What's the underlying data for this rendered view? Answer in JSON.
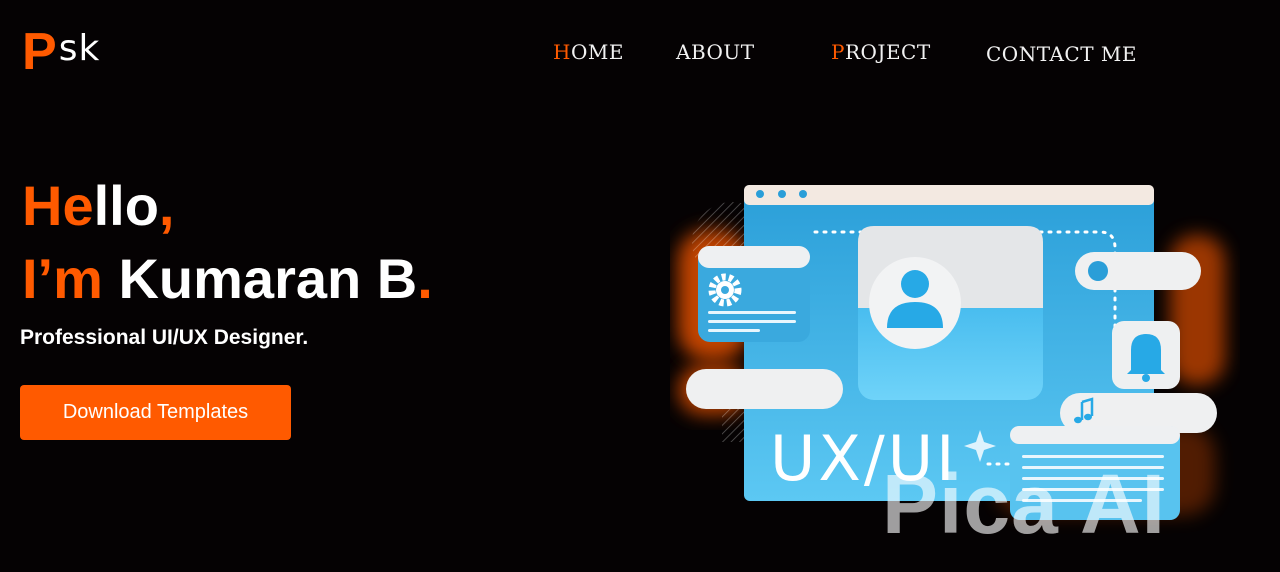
{
  "logo": {
    "initial": "P",
    "rest": "sk"
  },
  "nav": [
    {
      "first": "H",
      "rest": "OME"
    },
    {
      "first": "",
      "rest": "ABOUT"
    },
    {
      "first": "P",
      "rest": "ROJECT"
    },
    {
      "first": "",
      "rest": "CONTACT ME"
    }
  ],
  "hero": {
    "line1": {
      "accent": "He",
      "plain": "llo",
      "end": ","
    },
    "line2": {
      "accent": "I’m",
      "plain": " Kumaran B",
      "end": "."
    },
    "subtitle": "Professional UI/UX Designer.",
    "cta_label": "Download Templates"
  },
  "illustration": {
    "text": "UX/UI",
    "icons": [
      "gear-icon",
      "user-icon",
      "bell-icon",
      "music-note-icon",
      "sparkle-icon"
    ]
  },
  "watermark": "Pica AI",
  "colors": {
    "accent": "#ff5a00",
    "background": "#050203",
    "card_blue": "#29a8e0",
    "card_light": "#e9ecef"
  }
}
